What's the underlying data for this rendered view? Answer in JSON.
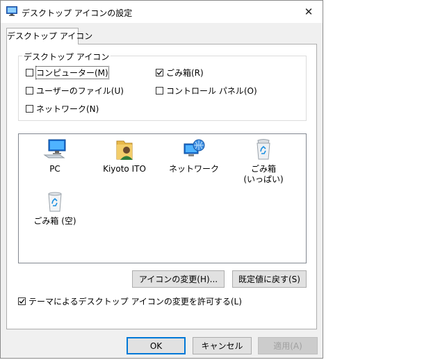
{
  "window": {
    "title": "デスクトップ アイコンの設定",
    "close_label": "✕"
  },
  "tabs": [
    {
      "label": "デスクトップ アイコン"
    }
  ],
  "group": {
    "label": "デスクトップ アイコン",
    "checkboxes": [
      {
        "label": "コンピューター(M)",
        "checked": false
      },
      {
        "label": "ごみ箱(R)",
        "checked": true
      },
      {
        "label": "ユーザーのファイル(U)",
        "checked": false
      },
      {
        "label": "コントロール パネル(O)",
        "checked": false
      },
      {
        "label": "ネットワーク(N)",
        "checked": false
      }
    ]
  },
  "icons": [
    {
      "label": "PC",
      "icon": "pc-icon"
    },
    {
      "label": "Kiyoto ITO",
      "icon": "user-folder-icon"
    },
    {
      "label": "ネットワーク",
      "icon": "network-icon"
    },
    {
      "label": "ごみ箱\n(いっぱい)",
      "icon": "recycle-bin-full-icon"
    },
    {
      "label": "ごみ箱 (空)",
      "icon": "recycle-bin-empty-icon"
    }
  ],
  "buttons": {
    "change_icon": "アイコンの変更(H)...",
    "restore_default": "既定値に戻す(S)",
    "ok": "OK",
    "cancel": "キャンセル",
    "apply": "適用(A)"
  },
  "theme_checkbox": {
    "label": "テーマによるデスクトップ アイコンの変更を許可する(L)",
    "checked": true
  }
}
